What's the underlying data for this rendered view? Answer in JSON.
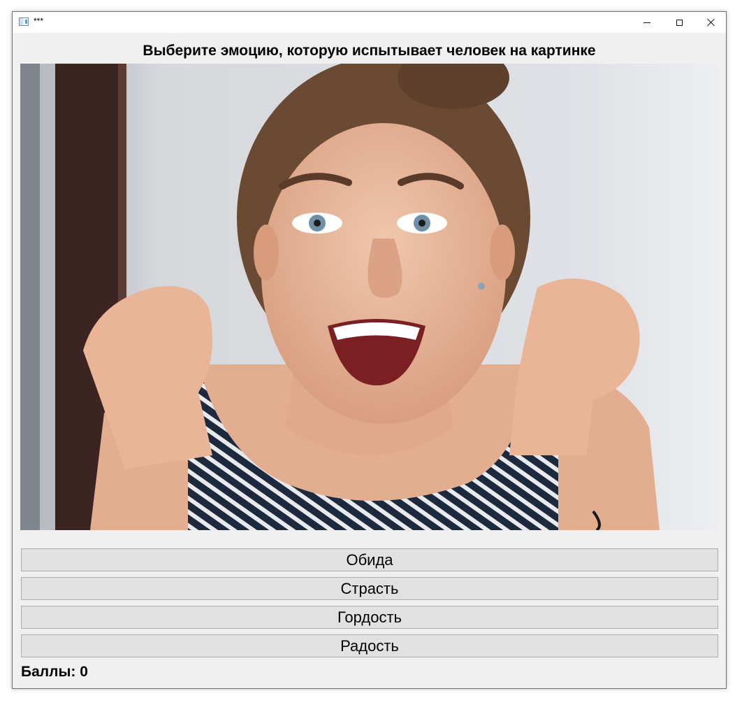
{
  "window": {
    "title": "***",
    "icon": "app-window-icon",
    "controls": {
      "minimize_icon": "minimize-icon",
      "maximize_icon": "maximize-icon",
      "close_icon": "close-icon"
    }
  },
  "main": {
    "heading": "Выберите эмоцию, которую испытывает человек на картинке",
    "image": {
      "subject": "excited woman with clenched fists, wide open smile"
    },
    "options": [
      {
        "label": "Обида"
      },
      {
        "label": "Страсть"
      },
      {
        "label": "Гордость"
      },
      {
        "label": "Радость"
      }
    ],
    "score_label": "Баллы:",
    "score_value": "0"
  }
}
